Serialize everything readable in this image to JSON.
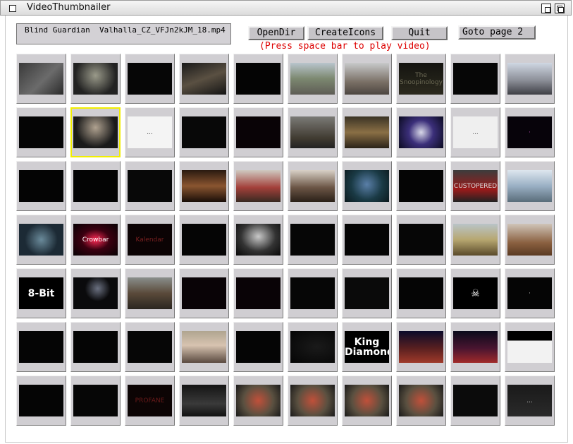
{
  "window": {
    "title": "VideoThumbnailer"
  },
  "toolbar": {
    "filename": "Blind Guardian  Valhalla_CZ_VFJn2kJM_18.mp4",
    "open_dir_label": "OpenDir",
    "create_icons_label": "CreateIcons",
    "quit_label": "Quit",
    "goto_label": "Goto page 2",
    "hint": "(Press space bar to play video)"
  },
  "colors": {
    "accent_selected": "#f2ee00",
    "hint_text": "#dd0000",
    "thumb_frame": "#d0ced2"
  },
  "selected_index": 11,
  "thumbnails": [
    {
      "bg": "linear-gradient(135deg,#3a3a3a,#6b6b6b 55%,#2a2a2a)"
    },
    {
      "bg": "radial-gradient(circle at 50% 40%,#9a9a8a,#222 70%)"
    },
    {
      "bg": "#060606"
    },
    {
      "bg": "linear-gradient(160deg,#1a1a1a,#5a5042 50%,#141414)"
    },
    {
      "bg": "#040404"
    },
    {
      "bg": "linear-gradient(180deg,#b8c4cc,#7c8870 50%,#5e5c55)"
    },
    {
      "bg": "linear-gradient(180deg,#c7c9ca,#7a7066 60%,#4c4540)"
    },
    {
      "bg": "linear-gradient(180deg,#141410,#2c2a1e)",
      "text": "The Snoopinology",
      "color": "#6d6a55"
    },
    {
      "bg": "#060606"
    },
    {
      "bg": "linear-gradient(180deg,#cfd7e2,#8c8f98 55%,#3e3f45)"
    },
    {
      "bg": "#050505"
    },
    {
      "bg": "radial-gradient(circle at 50% 35%,#b0a290,#1a1a1a 65%)"
    },
    {
      "bg": "#f4f4f4",
      "text": "...",
      "color": "#333"
    },
    {
      "bg": "#080808"
    },
    {
      "bg": "#090306"
    },
    {
      "bg": "linear-gradient(180deg,#7b7a76,#3f3a30 70%,#222)"
    },
    {
      "bg": "linear-gradient(180deg,#3a3325,#8a6f45 50%,#2a2218)"
    },
    {
      "bg": "radial-gradient(circle at 50% 50%,#d8d8e8,#3b2f7a 45%,#0b0b20)"
    },
    {
      "bg": "#efefef",
      "text": "...",
      "color": "#555"
    },
    {
      "bg": "#07030a",
      "text": "·",
      "color": "#aa44aa"
    },
    {
      "bg": "#040404"
    },
    {
      "bg": "#040404"
    },
    {
      "bg": "#080808"
    },
    {
      "bg": "linear-gradient(180deg,#2a1a10,#8a5530 50%,#1a0e08)"
    },
    {
      "bg": "linear-gradient(180deg,#cfc9c0,#a3403a 55%,#3a2a22)"
    },
    {
      "bg": "linear-gradient(180deg,#d8d0c6,#6b5545 55%,#2a2018)"
    },
    {
      "bg": "radial-gradient(circle at 50% 45%,#5a7fa8,#1a3a45 55%,#0c1a1e)"
    },
    {
      "bg": "#050505"
    },
    {
      "bg": "linear-gradient(180deg,#3c3c3c,#9b1a1a 60%,#222)",
      "text": "CUSTOPERED",
      "color": "#ddd"
    },
    {
      "bg": "linear-gradient(180deg,#dde6ee,#9ab0c4 50%,#5a6d7a)"
    },
    {
      "bg": "radial-gradient(circle at 50% 50%,#6a8a9a,#1c2a35 60%)"
    },
    {
      "bg": "radial-gradient(ellipse at 50% 50%,#ff2a55,#3a0010 45%,#070204)",
      "text": "Crowbar",
      "color": "#fff"
    },
    {
      "bg": "#0b0304",
      "text": "Kalendar",
      "color": "#7a2020"
    },
    {
      "bg": "#050505"
    },
    {
      "bg": "radial-gradient(ellipse at 50% 40%,#c9c9c9,#333 55%,#080808)"
    },
    {
      "bg": "#060606"
    },
    {
      "bg": "#050505"
    },
    {
      "bg": "#060606"
    },
    {
      "bg": "linear-gradient(180deg,#b9c4c8,#b7a770 50%,#5a4a2a)"
    },
    {
      "bg": "linear-gradient(180deg,#cfc4b8,#8a6040 60%,#5a3a22)"
    },
    {
      "bg": "#000000",
      "text": "8-Bit",
      "color": "#fff",
      "bold": true
    },
    {
      "bg": "radial-gradient(circle at 55% 35%,#6a7080,#0a0a0c 40%)"
    },
    {
      "bg": "linear-gradient(180deg,#8a8f8c,#5a4a3a 50%,#2a2620)"
    },
    {
      "bg": "#090306"
    },
    {
      "bg": "#090306"
    },
    {
      "bg": "#060606"
    },
    {
      "bg": "#0a0a0a"
    },
    {
      "bg": "#050505"
    },
    {
      "bg": "#000000",
      "text": "☠",
      "color": "#fff",
      "bold": true
    },
    {
      "bg": "#050505",
      "text": "·",
      "color": "#bbb"
    },
    {
      "bg": "#050505"
    },
    {
      "bg": "#050505"
    },
    {
      "bg": "#060606"
    },
    {
      "bg": "linear-gradient(180deg,#b0a590,#d7c3b0 45%,#5a4a40)"
    },
    {
      "bg": "#050505"
    },
    {
      "bg": "radial-gradient(ellipse at 60% 50%,#1a1a1a,#050505)"
    },
    {
      "bg": "#000000",
      "text": "King Diamond",
      "color": "#fff",
      "bold": true
    },
    {
      "bg": "linear-gradient(180deg,#0a0a2a,#5a2020 55%,#a03a2a)"
    },
    {
      "bg": "linear-gradient(180deg,#0a0a1a,#4a1530 55%,#a02a2a)"
    },
    {
      "bg": "linear-gradient(180deg,#000 30%,#f2f2f2 30%)"
    },
    {
      "bg": "#050505"
    },
    {
      "bg": "#060606"
    },
    {
      "bg": "#0c0404",
      "text": "PROFANE",
      "color": "#6a1a1a"
    },
    {
      "bg": "linear-gradient(180deg,#141414,#3a3a3a 60%,#111)"
    },
    {
      "bg": "radial-gradient(circle at 50% 50%,#c0503a,#5a5040 55%,#1a1a1a)"
    },
    {
      "bg": "radial-gradient(circle at 50% 50%,#c0503a,#5a5040 55%,#1a1a1a)"
    },
    {
      "bg": "radial-gradient(circle at 50% 50%,#c0503a,#5a5040 55%,#1a1a1a)"
    },
    {
      "bg": "radial-gradient(circle at 50% 50%,#c0503a,#5a5040 55%,#1a1a1a)"
    },
    {
      "bg": "#0b0b0b"
    },
    {
      "bg": "linear-gradient(180deg,#1a1a1a,#2a2a2a)",
      "text": "...",
      "color": "#ccc"
    }
  ]
}
